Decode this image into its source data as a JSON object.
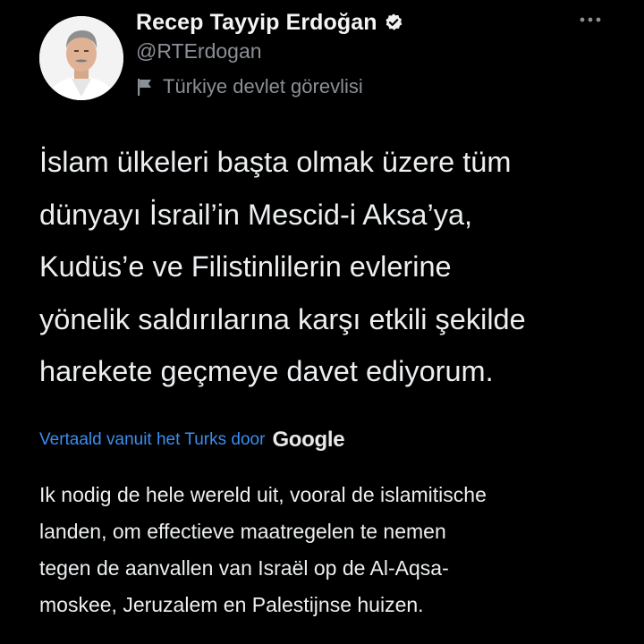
{
  "tweet": {
    "author": {
      "display_name": "Recep Tayyip Erdoğan",
      "handle": "@RTErdogan",
      "verified": true,
      "affiliation_label": "Türkiye devlet görevlisi",
      "affiliation_icon": "flag-icon"
    },
    "more_icon": "more-options-icon",
    "text": "İslam ülkeleri başta olmak üzere tüm\ndünyayı İsrail’in Mescid-i Aksa’ya,\nKudüs’e ve Filistinlilerin evlerine\nyönelik saldırılarına karşı etkili şekilde\nharekete geçmeye davet ediyorum.",
    "translation": {
      "label": "Vertaald vanuit het Turks door",
      "provider": "Google",
      "text": "Ik nodig de hele wereld uit, vooral de islamitische\nlanden, om effectieve maatregelen te nemen\ntegen de aanvallen van Israël op de Al-Aqsa-\nmoskee, Jeruzalem en Palestijnse huizen."
    }
  },
  "colors": {
    "background": "#000000",
    "primary_text": "#e7e9ea",
    "secondary_text": "#8b9096",
    "link": "#3a8ff0"
  }
}
